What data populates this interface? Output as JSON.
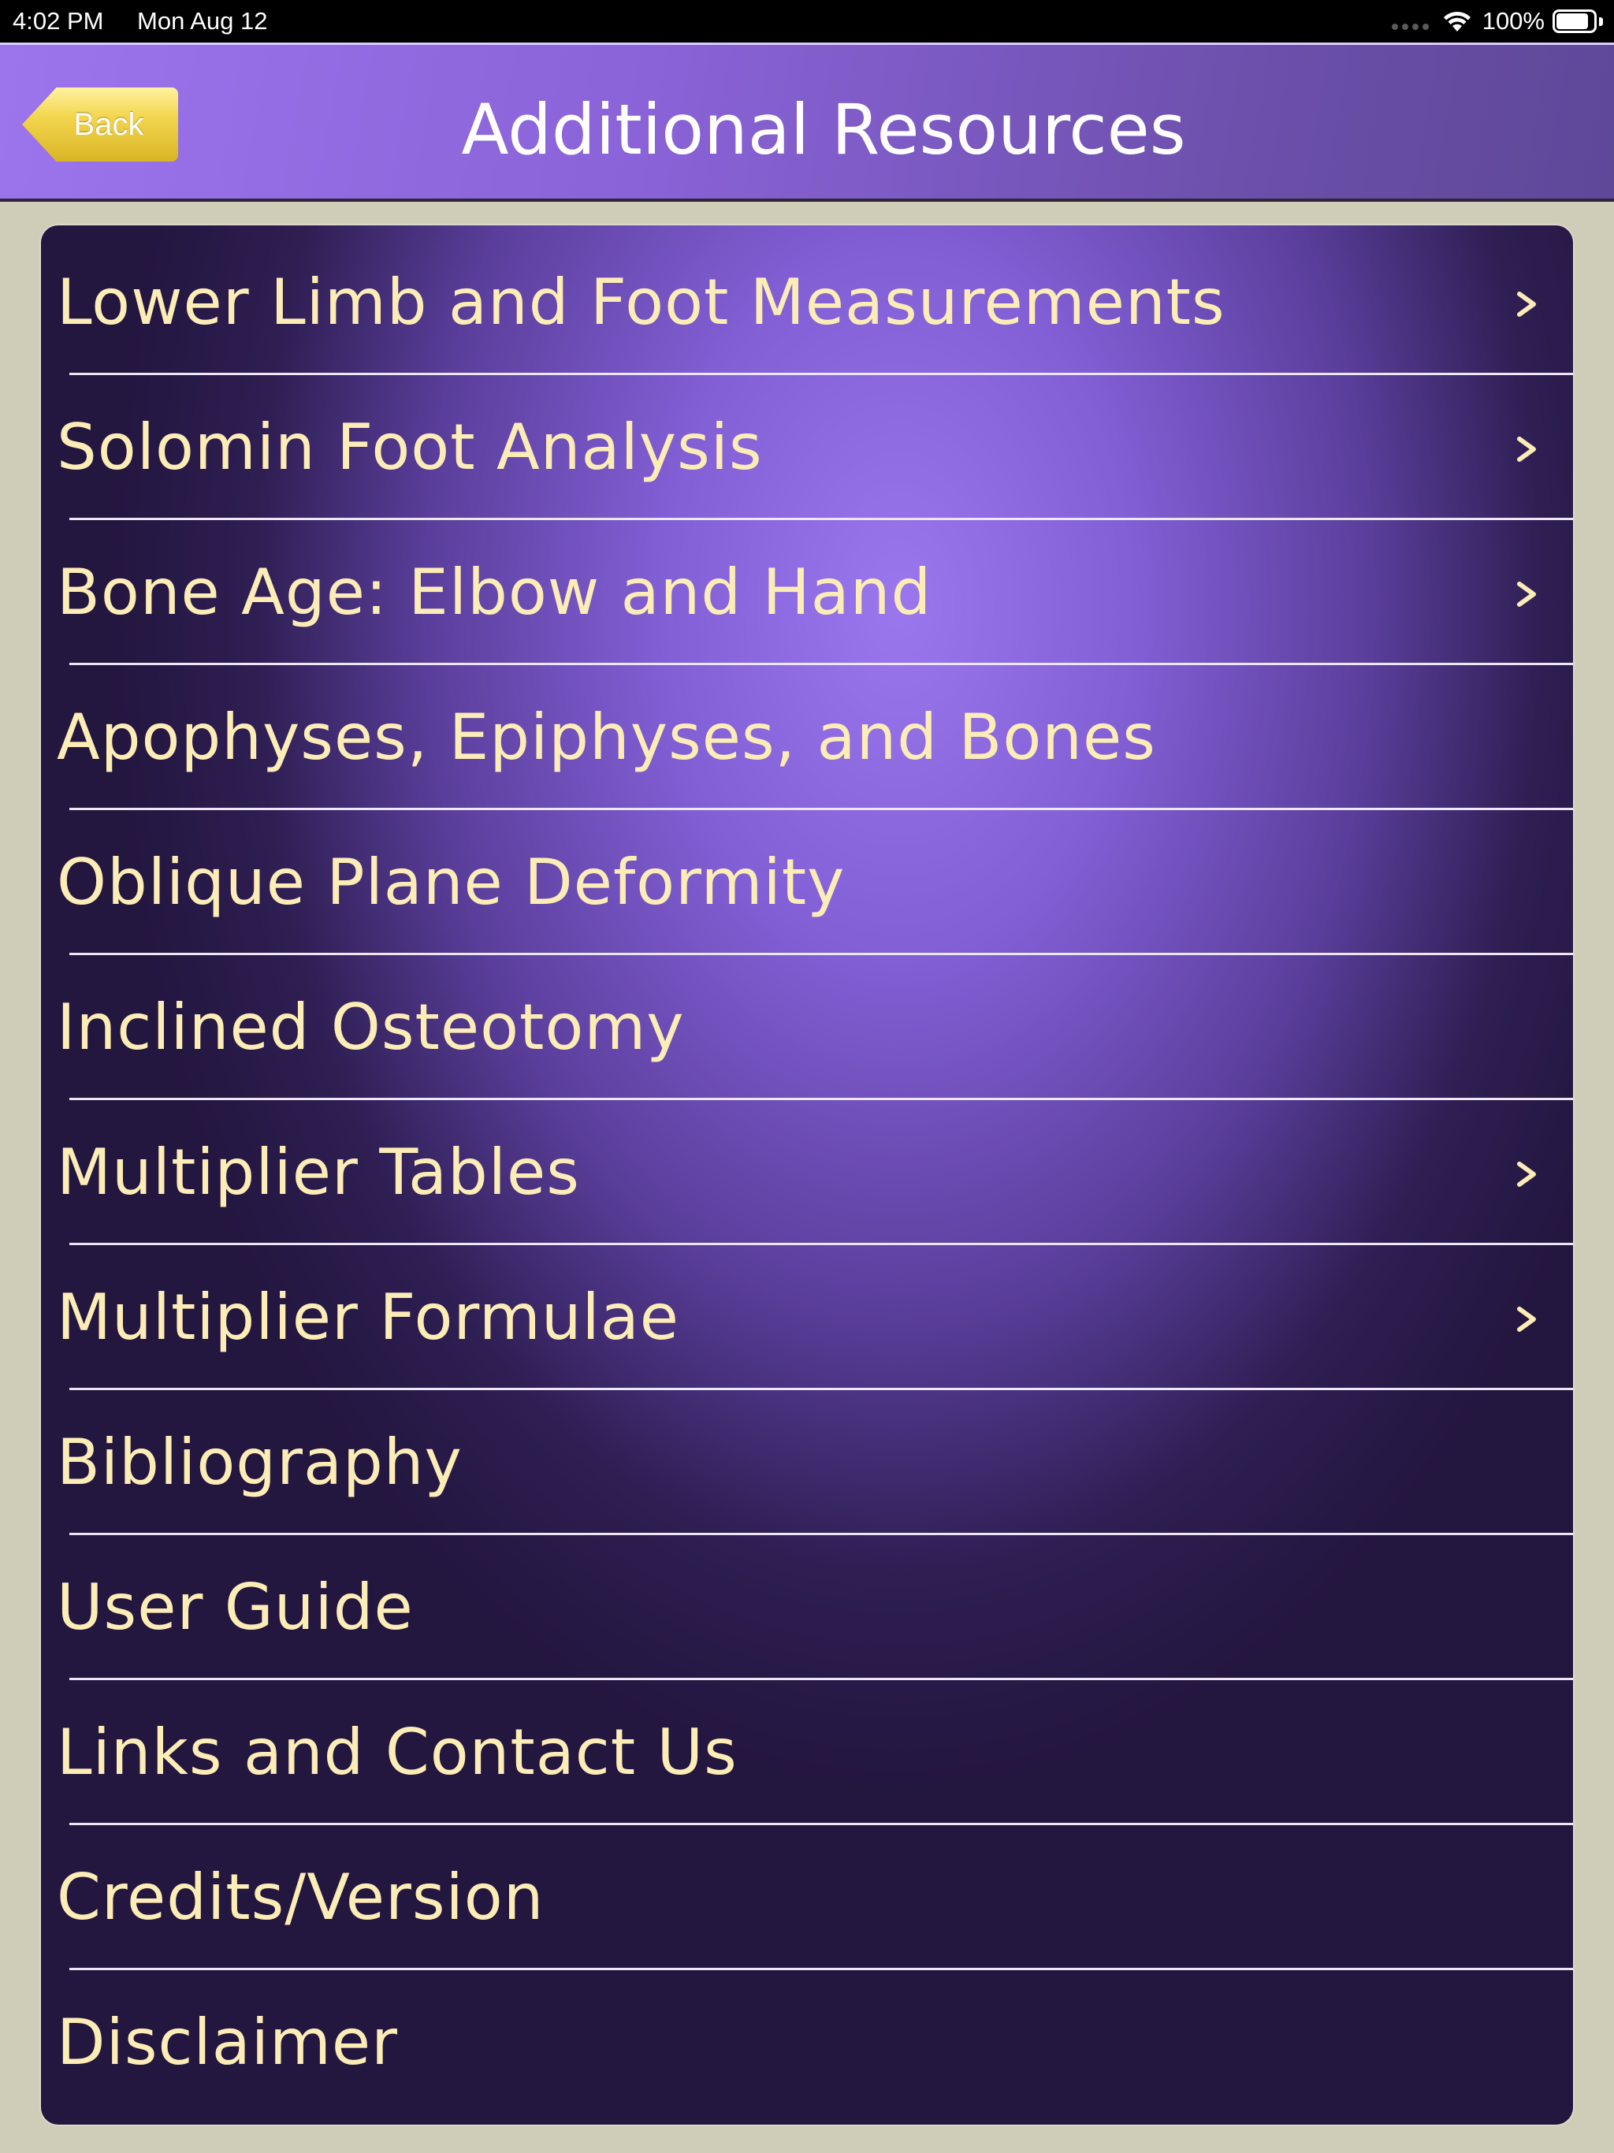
{
  "status_bar": {
    "time": "4:02 PM",
    "date": "Mon Aug 12",
    "battery_percent_label": "100%",
    "battery_level": 1.0
  },
  "nav": {
    "back_label": "Back",
    "title": "Additional Resources"
  },
  "menu": {
    "items": [
      {
        "label": "Lower Limb and Foot Measurements",
        "has_disclosure": true
      },
      {
        "label": "Solomin Foot Analysis",
        "has_disclosure": true
      },
      {
        "label": "Bone Age: Elbow and Hand",
        "has_disclosure": true
      },
      {
        "label": "Apophyses, Epiphyses, and Bones",
        "has_disclosure": false
      },
      {
        "label": "Oblique Plane Deformity",
        "has_disclosure": false
      },
      {
        "label": "Inclined Osteotomy",
        "has_disclosure": false
      },
      {
        "label": "Multiplier Tables",
        "has_disclosure": true
      },
      {
        "label": "Multiplier Formulae",
        "has_disclosure": true
      },
      {
        "label": "Bibliography",
        "has_disclosure": false
      },
      {
        "label": "User Guide",
        "has_disclosure": false
      },
      {
        "label": "Links and Contact Us",
        "has_disclosure": false
      },
      {
        "label": "Credits/Version",
        "has_disclosure": false
      },
      {
        "label": "Disclaimer",
        "has_disclosure": false
      }
    ]
  },
  "colors": {
    "nav_gradient_start": "#9c74ec",
    "nav_gradient_end": "#5e4898",
    "row_text": "#fcecb6",
    "back_button": "#f3d54e",
    "page_background": "#cfcdb8"
  },
  "icons": {
    "row_disclosure": "chevron-right-icon",
    "wifi": "wifi-icon",
    "battery": "battery-icon"
  }
}
